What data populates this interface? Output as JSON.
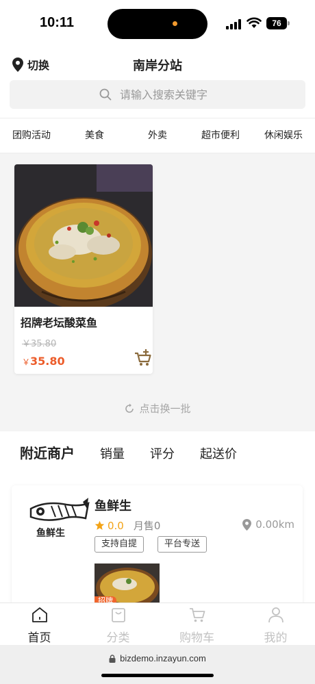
{
  "status_bar": {
    "time": "10:11",
    "battery": "76"
  },
  "header": {
    "switch_label": "切换",
    "title": "南岸分站"
  },
  "search": {
    "placeholder": "请输入搜索关键字"
  },
  "categories": [
    "团购活动",
    "美食",
    "外卖",
    "超市便利",
    "休闲娱乐"
  ],
  "product": {
    "name": "招牌老坛酸菜鱼",
    "old_price": "￥35.80",
    "currency": "￥",
    "price": "35.80"
  },
  "refresh_label": "点击换一批",
  "sort_tabs": [
    "附近商户",
    "销量",
    "评分",
    "起送价"
  ],
  "merchant": {
    "name": "鱼鲜生",
    "rating": "0.0",
    "sales": "月售0",
    "distance": "0.00km",
    "tags": [
      "支持自提",
      "平台专送"
    ],
    "thumb_badge": "招牌",
    "logo_text": "鱼鲜生"
  },
  "tabbar": [
    {
      "label": "首页",
      "icon": "home-icon",
      "active": true
    },
    {
      "label": "分类",
      "icon": "bag-icon",
      "active": false
    },
    {
      "label": "购物车",
      "icon": "cart-icon",
      "active": false
    },
    {
      "label": "我的",
      "icon": "user-icon",
      "active": false
    }
  ],
  "url": "bizdemo.inzayun.com",
  "colors": {
    "price": "#ec5c2a",
    "rating": "#f3a316",
    "badge": "#f0652d"
  }
}
